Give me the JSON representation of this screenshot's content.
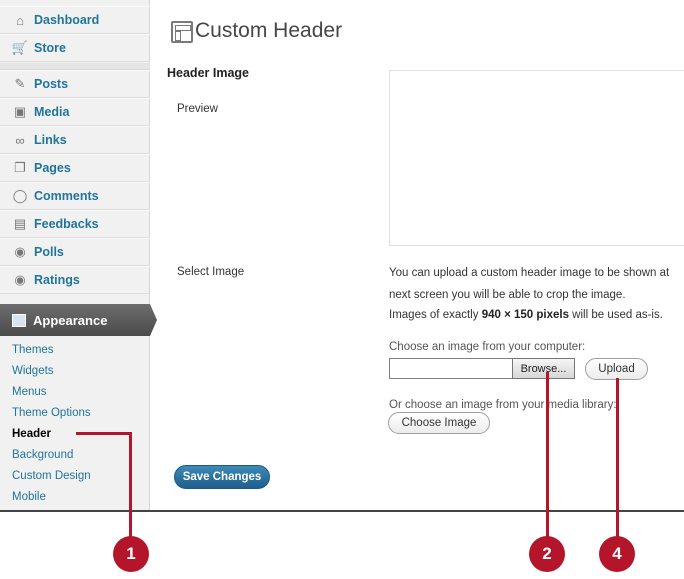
{
  "sidebar": {
    "top_items": [
      {
        "label": "Dashboard",
        "icon": "home-icon",
        "glyph": "⌂"
      },
      {
        "label": "Store",
        "icon": "cart-icon",
        "glyph": "🛒"
      }
    ],
    "items": [
      {
        "label": "Posts",
        "icon": "pushpin-icon",
        "glyph": "✎"
      },
      {
        "label": "Media",
        "icon": "media-icon",
        "glyph": "▣"
      },
      {
        "label": "Links",
        "icon": "link-icon",
        "glyph": "∞"
      },
      {
        "label": "Pages",
        "icon": "pages-icon",
        "glyph": "❐"
      },
      {
        "label": "Comments",
        "icon": "comment-bubble-icon",
        "glyph": "◯"
      },
      {
        "label": "Feedbacks",
        "icon": "feedback-icon",
        "glyph": "▤"
      },
      {
        "label": "Polls",
        "icon": "polls-icon",
        "glyph": "◉"
      },
      {
        "label": "Ratings",
        "icon": "ratings-icon",
        "glyph": "◉"
      }
    ],
    "appearance_label": "Appearance",
    "sub_items": [
      "Themes",
      "Widgets",
      "Menus",
      "Theme Options",
      "Header",
      "Background",
      "Custom Design",
      "Mobile"
    ],
    "current_sub_item": "Header"
  },
  "main": {
    "page_title": "Custom Header",
    "section_title": "Header Image",
    "preview_label": "Preview",
    "select_image_label": "Select Image",
    "desc_line1": "You can upload a custom header image to be shown at",
    "desc_line2": "next screen you will be able to crop the image.",
    "desc_line3_prefix": "Images of exactly ",
    "desc_line3_bold": "940 × 150 pixels",
    "desc_line3_suffix": " will be used as-is.",
    "choose_from_computer": "Choose an image from your computer:",
    "browse_button": "Browse...",
    "upload_button": "Upload",
    "or_choose_library": "Or choose an image from your media library:",
    "choose_image_button": "Choose Image",
    "save_button": "Save Changes"
  },
  "callouts": [
    "1",
    "2",
    "4"
  ],
  "colors": {
    "callout": "#b5152b",
    "link": "#21759b",
    "save_button": "#1f5e8b"
  }
}
